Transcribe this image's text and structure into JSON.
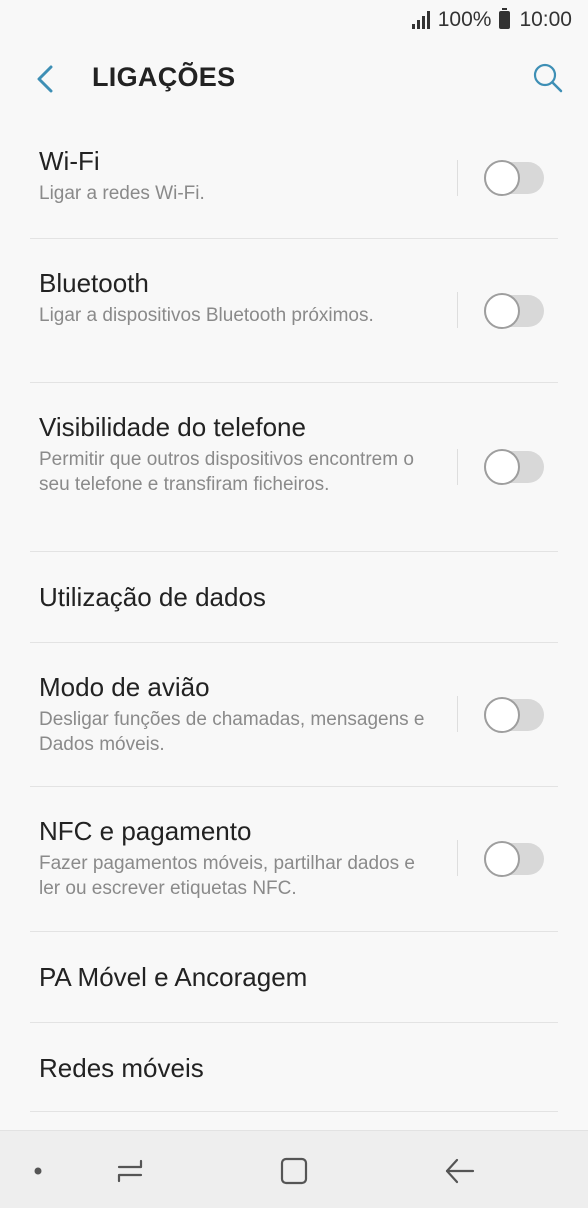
{
  "status_bar": {
    "battery": "100%",
    "time": "10:00"
  },
  "header": {
    "title": "LIGAÇÕES"
  },
  "items": [
    {
      "label": "Wi-Fi",
      "desc": "Ligar a redes Wi-Fi.",
      "toggle": false
    },
    {
      "label": "Bluetooth",
      "desc": "Ligar a dispositivos Bluetooth próximos.",
      "toggle": false
    },
    {
      "label": "Visibilidade do telefone",
      "desc": "Permitir que outros dispositivos encontrem o seu telefone e transfiram ficheiros.",
      "toggle": false
    },
    {
      "label": "Utilização de dados"
    },
    {
      "label": "Modo de avião",
      "desc": "Desligar funções de chamadas, mensagens e Dados móveis.",
      "toggle": false
    },
    {
      "label": "NFC e pagamento",
      "desc": "Fazer pagamentos móveis, partilhar dados e ler ou escrever etiquetas NFC.",
      "toggle": false
    },
    {
      "label": "PA Móvel e Ancoragem"
    },
    {
      "label": "Redes móveis"
    }
  ],
  "colors": {
    "accent": "#3e8fb5",
    "background": "#f8f8f8",
    "nav_background": "#eeeeee"
  },
  "icons": {
    "back": "chevron-left-icon",
    "search": "search-icon",
    "recents": "recents-icon",
    "home": "home-icon",
    "nav_back": "back-arrow-icon"
  }
}
